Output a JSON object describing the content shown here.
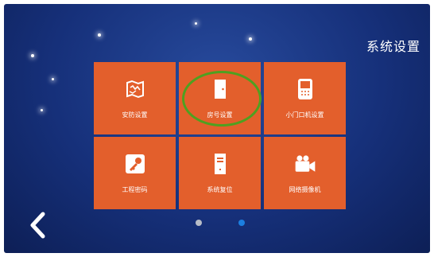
{
  "screen": {
    "title": "系统设置"
  },
  "tiles": [
    {
      "label": "安防设置",
      "icon": "map-icon"
    },
    {
      "label": "房号设置",
      "icon": "door-icon"
    },
    {
      "label": "小门口机设置",
      "icon": "intercom-device-icon"
    },
    {
      "label": "工程密码",
      "icon": "key-icon"
    },
    {
      "label": "系统复位",
      "icon": "tower-pc-icon"
    },
    {
      "label": "网络摄像机",
      "icon": "video-camera-icon"
    }
  ],
  "pagination": {
    "page_count": 2,
    "current_page": 2
  },
  "colors": {
    "background": "#16307a",
    "tile": "#e35f2c",
    "annotation": "#4fa020",
    "active_dot": "#1c7fe0",
    "inactive_dot": "#b7bcc7"
  }
}
